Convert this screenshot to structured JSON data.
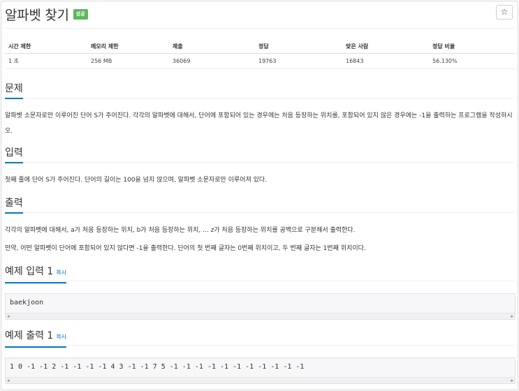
{
  "problem": {
    "title": "알파벳 찾기",
    "badge": "성공",
    "star_icon": "☆"
  },
  "info_table": {
    "headers": [
      "시간 제한",
      "메모리 제한",
      "제출",
      "정답",
      "맞은 사람",
      "정답 비율"
    ],
    "values": [
      "1 초",
      "256 MB",
      "36069",
      "19763",
      "16843",
      "56.130%"
    ]
  },
  "sections": {
    "description": {
      "heading": "문제",
      "text": "알파벳 소문자로만 이루어진 단어 S가 주어진다. 각각의 알파벳에 대해서, 단어에 포함되어 있는 경우에는 처음 등장하는 위치를, 포함되어 있지 않은 경우에는 -1을 출력하는 프로그램을 작성하시오."
    },
    "input": {
      "heading": "입력",
      "text": "첫째 줄에 단어 S가 주어진다. 단어의 길이는 100을 넘지 않으며, 알파벳 소문자로만 이루어져 있다."
    },
    "output": {
      "heading": "출력",
      "text1": "각각의 알파벳에 대해서, a가 처음 등장하는 위치, b가 처음 등장하는 위치, ... z가 처음 등장하는 위치를 공백으로 구분해서 출력한다.",
      "text2": "만약, 어떤 알파벳이 단어에 포함되어 있지 않다면 -1을 출력한다. 단어의 첫 번째 글자는 0번째 위치이고, 두 번째 글자는 1번째 위치이다."
    },
    "sample_input": {
      "heading": "예제 입력 1",
      "copy_label": "복사",
      "content": "baekjoon"
    },
    "sample_output": {
      "heading": "예제 출력 1",
      "copy_label": "복사",
      "content": "1 0 -1 -1 2 -1 -1 -1 -1 4 3 -1 -1 7 5 -1 -1 -1 -1 -1 -1 -1 -1 -1 -1 -1"
    }
  },
  "scrollbar": {
    "left_arrow": "◂",
    "right_arrow": "▸"
  }
}
